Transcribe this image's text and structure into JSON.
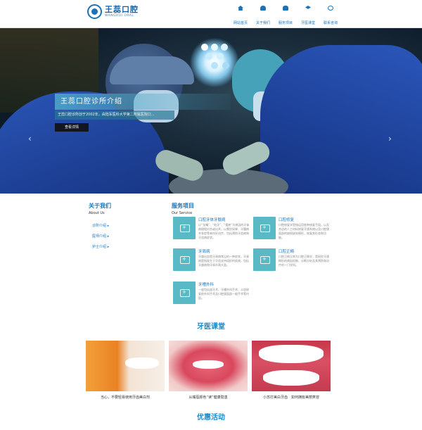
{
  "brand": {
    "name_cn": "王蕊口腔",
    "name_en": "WANGRUI ORAL"
  },
  "nav": [
    {
      "label": "网站首页",
      "icon": "home-icon"
    },
    {
      "label": "关于我们",
      "icon": "person-icon"
    },
    {
      "label": "服务项目",
      "icon": "tooth-icon"
    },
    {
      "label": "牙医课堂",
      "icon": "graduation-cap-icon"
    },
    {
      "label": "联系咨询",
      "icon": "phone-icon"
    }
  ],
  "banner": {
    "title": "王蕊口腔诊所介绍",
    "subtitle": "王蕊口腔诊所创于2002年，由陆军医科大学第二附属医院口...",
    "button": "查看详情",
    "prev_arrow": "‹",
    "next_arrow": "›"
  },
  "about": {
    "title": "关于我们",
    "subtitle": "About Us",
    "items": [
      "诊所介绍 ▸",
      "医师介绍 ▸",
      "护士介绍 ▸"
    ]
  },
  "services": {
    "title": "服务项目",
    "subtitle": "Our Service",
    "items": [
      {
        "name": "口腔牙体牙髓病",
        "desc": "以“龙嘴”、“蛀牙”、“瘘疤”为原因的牙体病理相对合或出术，以需别如果、牙髓病并发症等来作好治疗，包括预防牙齿病和牙齿病症状。"
      },
      {
        "name": "口腔修复",
        "desc": "口腔修复学是指运用各种修复手段，以及合适的人工材料修复牙颌系统以及口腔颌面部的缺损缺失畸形，恢复其形态和功能。"
      },
      {
        "name": "牙周病",
        "desc": "牙龈出血是牙周病常见的一种症状，牙周病是指发生于牙齿支持组织的疾病，包括牙龈病和牙周炎两大类。"
      },
      {
        "name": "口腔正畸",
        "desc": "口腔正畸又称为口腔正畸学，是研究牙颌畸形的病因机制、诊断分析及其预防和治疗的一门学科。"
      },
      {
        "name": "牙槽外科",
        "desc": "一般包括拔牙术、牙槽外科手术、义齿修复前外科手术及口腔颌面部一般手术等内容。"
      }
    ]
  },
  "classroom": {
    "title": "牙医课堂",
    "items": [
      {
        "caption": "当心，不要轻易使用牙齿美白剂"
      },
      {
        "caption": "从嘴唇颜色“读”健康隐患"
      },
      {
        "caption": "小苏打美白牙齿　如何拥有美丽笑容"
      }
    ]
  },
  "promo": {
    "title": "优惠活动"
  }
}
